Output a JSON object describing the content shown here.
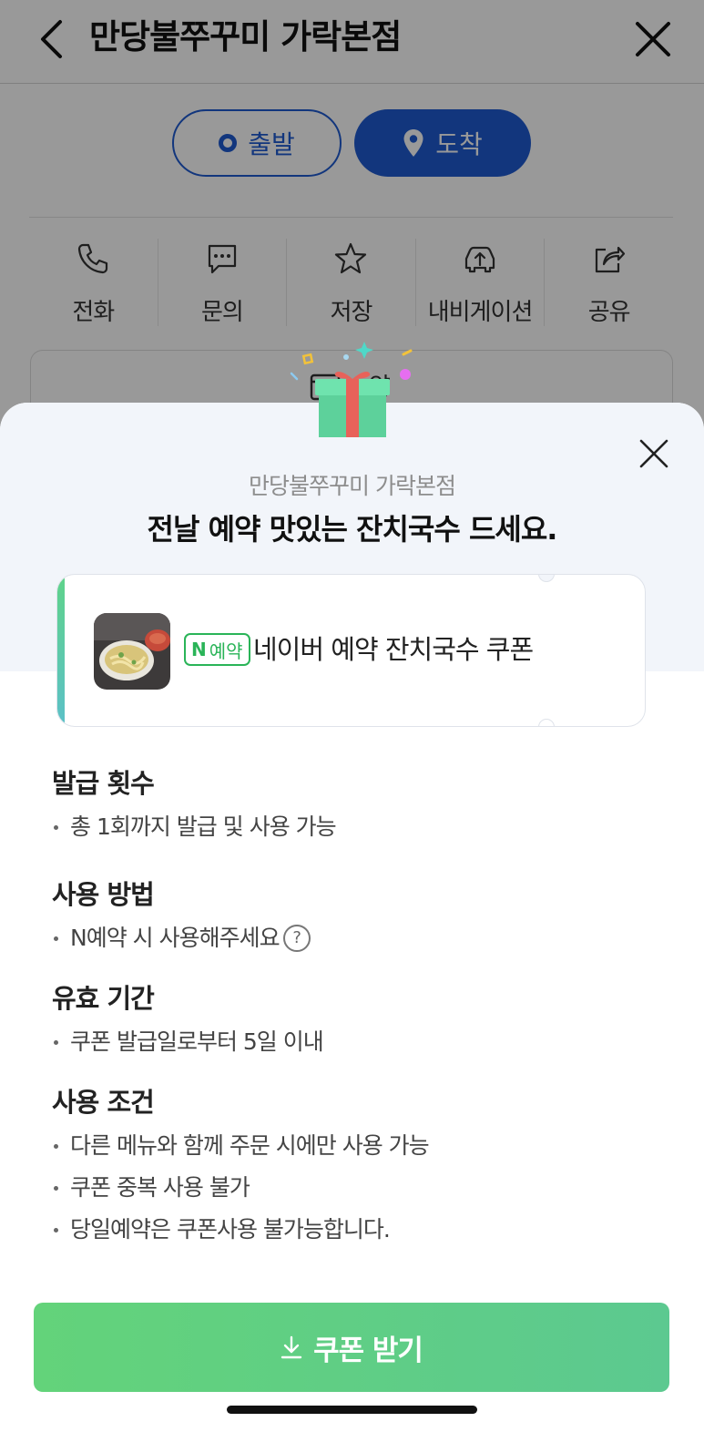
{
  "header": {
    "title": "만당불쭈꾸미 가락본점"
  },
  "route": {
    "depart_label": "출발",
    "arrive_label": "도착"
  },
  "actions": [
    {
      "label": "전화",
      "icon": "phone-icon"
    },
    {
      "label": "문의",
      "icon": "chat-icon"
    },
    {
      "label": "저장",
      "icon": "star-icon"
    },
    {
      "label": "내비게이션",
      "icon": "navigation-car-icon"
    },
    {
      "label": "공유",
      "icon": "share-icon"
    }
  ],
  "bg_card": {
    "label": "약"
  },
  "sheet": {
    "shop_name": "만당불쭈꾸미 가락본점",
    "headline": "전날 예약 맛있는 잔치국수 드세요.",
    "coupon": {
      "badge_n": "N",
      "badge_text": "예약",
      "title": "네이버 예약 잔치국수 쿠폰"
    },
    "sections": [
      {
        "title": "발급 횟수",
        "items": [
          "총 1회까지 발급 및 사용 가능"
        ]
      },
      {
        "title": "사용 방법",
        "items": [
          "N예약 시 사용해주세요"
        ],
        "help": "?"
      },
      {
        "title": "유효 기간",
        "items": [
          "쿠폰 발급일로부터 5일 이내"
        ]
      },
      {
        "title": "사용 조건",
        "items": [
          "다른 메뉴와 함께 주문 시에만 사용 가능",
          "쿠폰 중복 사용 불가",
          "당일예약은 쿠폰사용 불가능합니다."
        ]
      }
    ],
    "cta_label": "쿠폰 받기"
  },
  "colors": {
    "brand_blue": "#1f5bd0",
    "naver_green": "#2ab458",
    "cta_green": "#63d37a",
    "gift_box": "#5dd19b",
    "gift_ribbon": "#e8625a"
  }
}
